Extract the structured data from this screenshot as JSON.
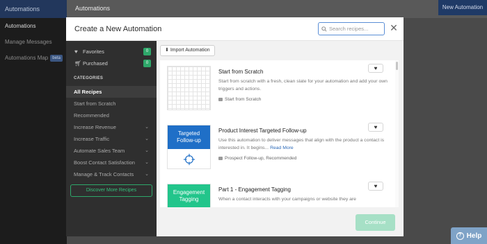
{
  "app": {
    "brand": "Automations",
    "header_title": "Automations",
    "new_automation_button": "New Automation",
    "nav": [
      {
        "label": "Automations",
        "active": true
      },
      {
        "label": "Manage Messages",
        "active": false
      },
      {
        "label": "Automations Map",
        "badge": "beta",
        "active": false
      }
    ],
    "help_label": "Help"
  },
  "modal": {
    "title": "Create a New Automation",
    "search_placeholder": "Search recipes...",
    "close_icon": "close-icon",
    "sidebar": {
      "favorites": {
        "label": "Favorites",
        "count": "0",
        "icon": "heart-icon"
      },
      "purchased": {
        "label": "Purchased",
        "count": "0",
        "icon": "cart-icon"
      },
      "categories_heading": "CATEGORIES",
      "categories": [
        {
          "label": "All Recipes",
          "active": true,
          "expandable": false
        },
        {
          "label": "Start from Scratch",
          "active": false,
          "expandable": false
        },
        {
          "label": "Recommended",
          "active": false,
          "expandable": false
        },
        {
          "label": "Increase Revenue",
          "active": false,
          "expandable": true
        },
        {
          "label": "Increase Traffic",
          "active": false,
          "expandable": true
        },
        {
          "label": "Automate Sales Team",
          "active": false,
          "expandable": true
        },
        {
          "label": "Boost Contact Satisfaction",
          "active": false,
          "expandable": true
        },
        {
          "label": "Manage & Track Contacts",
          "active": false,
          "expandable": true
        }
      ],
      "discover_button": "Discover More Recipes"
    },
    "import_button": "Import Automation",
    "recipes": [
      {
        "title": "Start from Scratch",
        "description": "Start from scratch with a fresh, clean slate for your automation and add your own triggers and actions.",
        "more": "",
        "tag": "Start from Scratch",
        "thumb_label": "",
        "thumb_color": ""
      },
      {
        "title": "Product Interest Targeted Follow-up",
        "description": "Use this automation to deliver messages that align with the product a contact is interested in. It begins...",
        "more": "Read More",
        "tag": "Prospect Follow-up, Recommended",
        "thumb_label": "Targeted Follow-up",
        "thumb_color": "#1f6fc7"
      },
      {
        "title": "Part 1 - Engagement Tagging",
        "description": "When a contact interacts with your campaigns or website they are",
        "more": "",
        "tag": "",
        "thumb_label": "Engagement Tagging",
        "thumb_color": "#22c58b"
      }
    ],
    "continue_button": "Continue"
  }
}
